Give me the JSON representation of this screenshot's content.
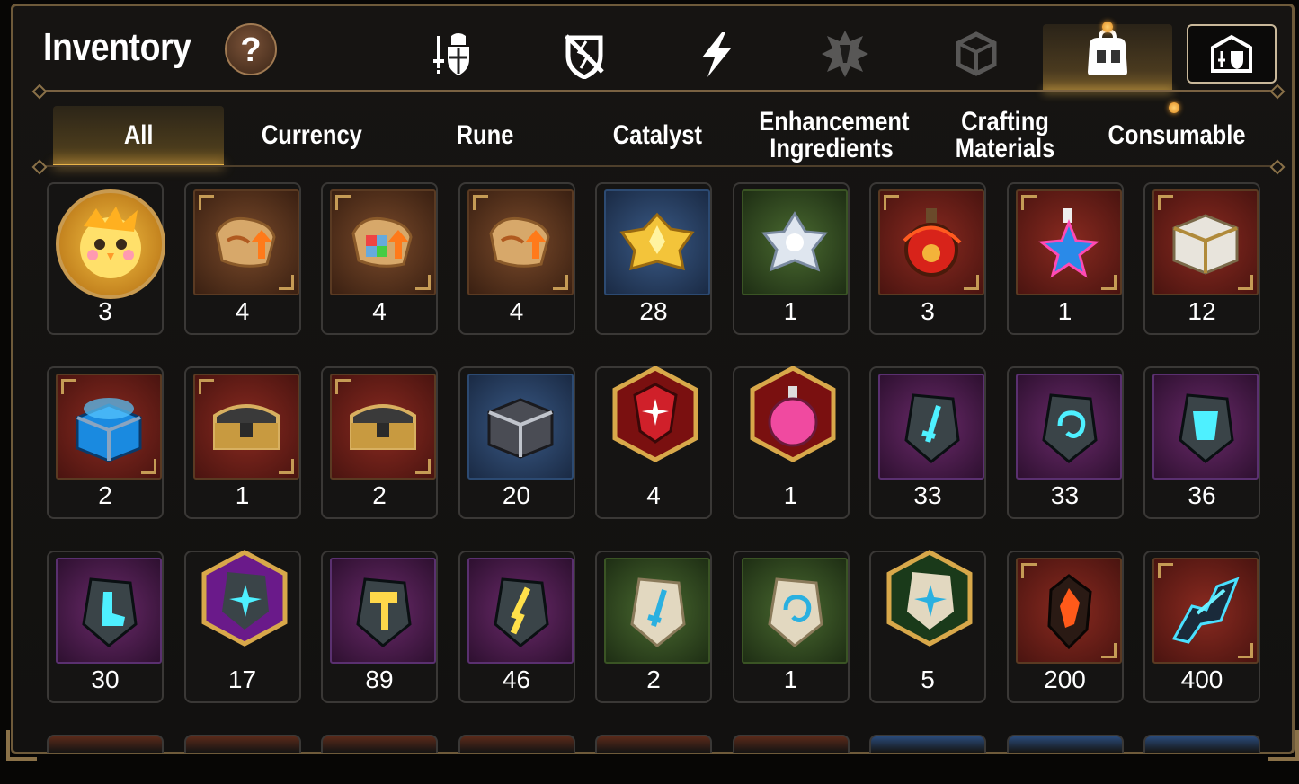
{
  "header": {
    "title": "Inventory",
    "help_icon": "?"
  },
  "top_tabs": [
    {
      "name": "equipment-sword-shield-icon",
      "active": false
    },
    {
      "name": "broken-shield-icon",
      "active": false
    },
    {
      "name": "lightning-icon",
      "active": false
    },
    {
      "name": "artifact-emblem-icon",
      "active": false
    },
    {
      "name": "cube-icon",
      "active": false
    },
    {
      "name": "bag-icon",
      "active": true
    },
    {
      "name": "guild-icon",
      "active": false
    }
  ],
  "categories": [
    "All",
    "Currency",
    "Rune",
    "Catalyst",
    "Enhancement Ingredients",
    "Crafting Materials",
    "Consumable"
  ],
  "active_category": "All",
  "items": [
    {
      "icon": "chick-portrait-icon",
      "count": "3",
      "bg": "round"
    },
    {
      "icon": "scroll-upgrade-icon",
      "count": "4",
      "bg": "brown"
    },
    {
      "icon": "rainbow-scroll-upgrade-icon",
      "count": "4",
      "bg": "brown"
    },
    {
      "icon": "scroll-upgrade-icon",
      "count": "4",
      "bg": "brown"
    },
    {
      "icon": "gold-crystal-icon",
      "count": "28",
      "bg": "blue"
    },
    {
      "icon": "silver-flower-icon",
      "count": "1",
      "bg": "green"
    },
    {
      "icon": "red-potion-icon",
      "count": "3",
      "bg": "red"
    },
    {
      "icon": "star-potion-icon",
      "count": "1",
      "bg": "red"
    },
    {
      "icon": "silver-chest-icon",
      "count": "12",
      "bg": "red"
    },
    {
      "icon": "blue-chest-icon",
      "count": "2",
      "bg": "red"
    },
    {
      "icon": "gold-chest-icon",
      "count": "1",
      "bg": "red"
    },
    {
      "icon": "gold-chest-icon",
      "count": "2",
      "bg": "red"
    },
    {
      "icon": "dark-cube-icon",
      "count": "20",
      "bg": "blue"
    },
    {
      "icon": "red-rune-hex-icon",
      "count": "4",
      "bg": "hex-red"
    },
    {
      "icon": "pink-potion-hex-icon",
      "count": "1",
      "bg": "hex-red"
    },
    {
      "icon": "sword-rune-icon",
      "count": "33",
      "bg": "purple"
    },
    {
      "icon": "spiral-rune-icon",
      "count": "33",
      "bg": "purple"
    },
    {
      "icon": "armor-rune-icon",
      "count": "36",
      "bg": "purple"
    },
    {
      "icon": "boot-rune-icon",
      "count": "30",
      "bg": "purple"
    },
    {
      "icon": "star-rune-hex-icon",
      "count": "17",
      "bg": "hex-purple"
    },
    {
      "icon": "hammer-rune-icon",
      "count": "89",
      "bg": "purple"
    },
    {
      "icon": "bolt-rune-icon",
      "count": "46",
      "bg": "purple"
    },
    {
      "icon": "sword-stone-icon",
      "count": "2",
      "bg": "green"
    },
    {
      "icon": "spiral-stone-icon",
      "count": "1",
      "bg": "green"
    },
    {
      "icon": "star-stone-hex-icon",
      "count": "5",
      "bg": "hex-green"
    },
    {
      "icon": "fire-ore-icon",
      "count": "200",
      "bg": "red"
    },
    {
      "icon": "ice-shard-icon",
      "count": "400",
      "bg": "red"
    }
  ],
  "colors": {
    "accent": "#e9b44a",
    "frame": "#6e5a3a",
    "background": "#161412"
  }
}
